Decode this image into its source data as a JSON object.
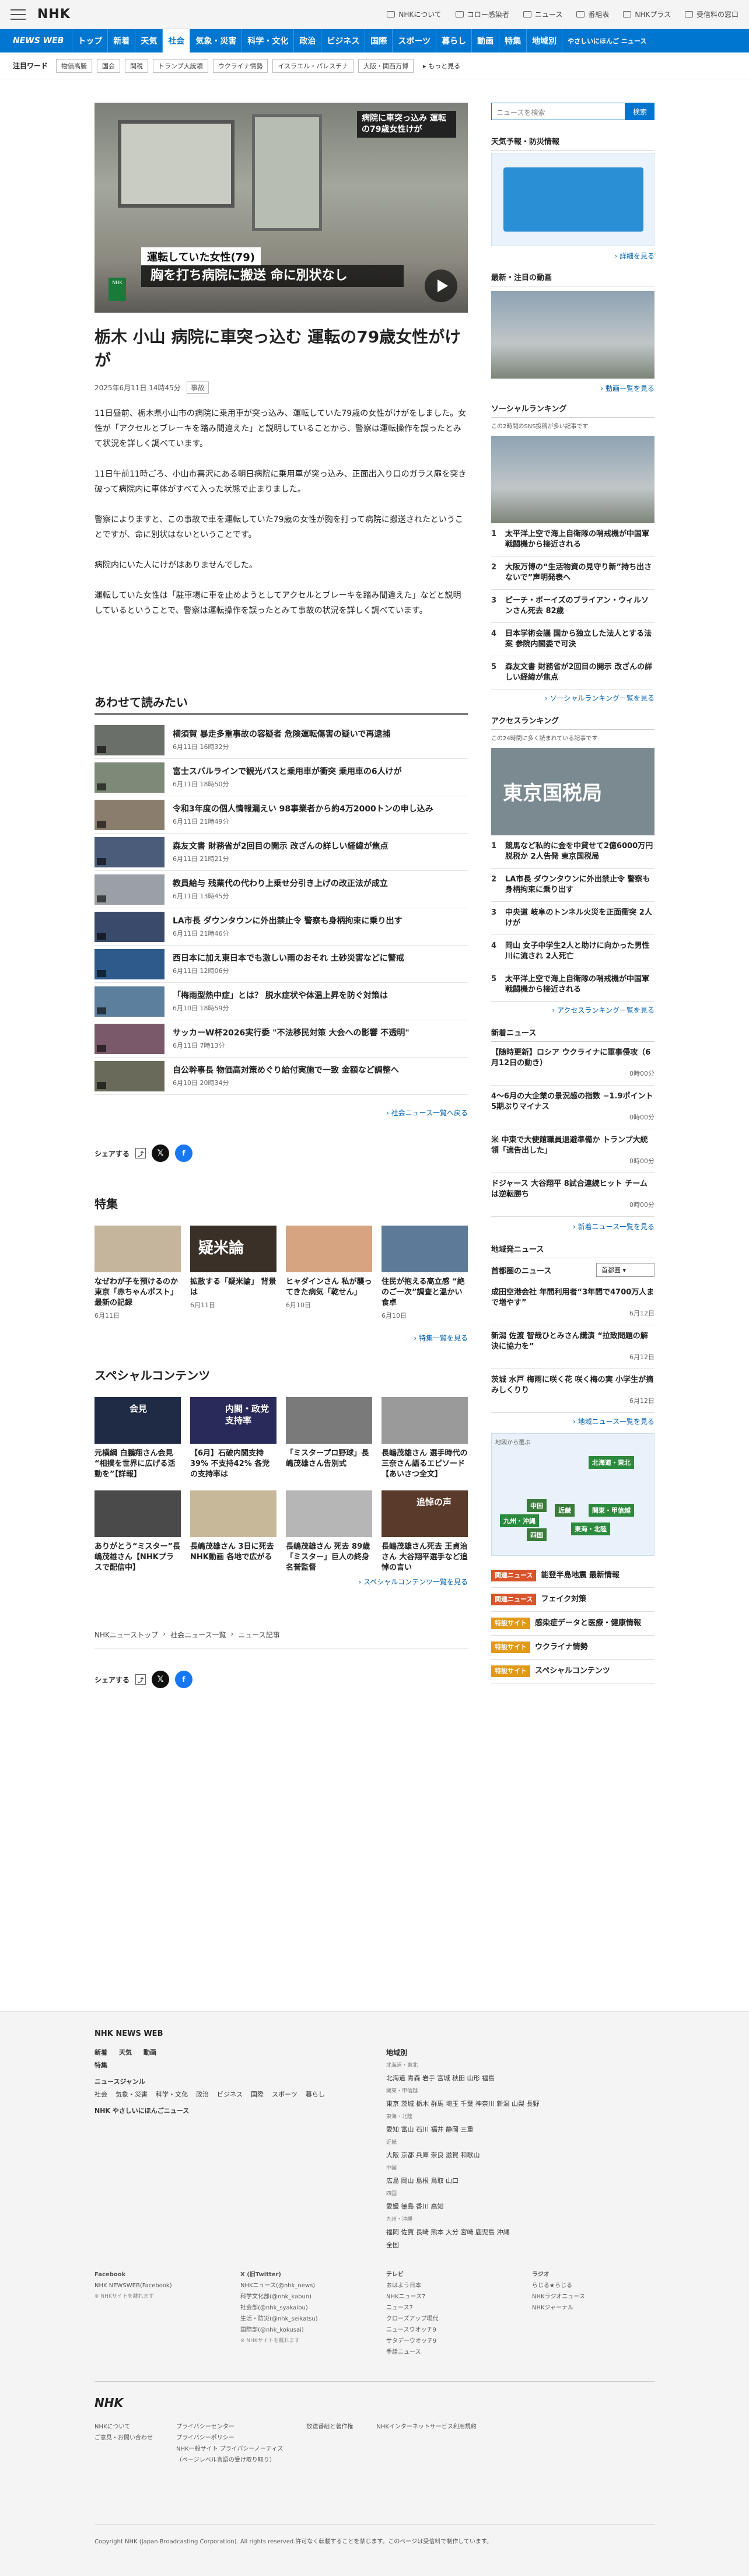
{
  "header": {
    "logo": "NHK",
    "links": [
      "NHKについて",
      "コロー感染者",
      "ニュース",
      "番組表",
      "NHKプラス",
      "受信料の窓口"
    ]
  },
  "gnav": {
    "brand": "NEWS WEB",
    "items": [
      "トップ",
      "新着",
      "天気",
      "社会",
      "気象・災害",
      "科学・文化",
      "政治",
      "ビジネス",
      "国際",
      "スポーツ",
      "暮らし",
      "動画",
      "特集",
      "地域別"
    ],
    "easy": "やさしいにほんご ニュース",
    "active": 3
  },
  "tags": {
    "label": "注目ワード",
    "items": [
      "物価高騰",
      "国会",
      "関税",
      "トランプ大統領",
      "ウクライナ情勢",
      "イスラエル・パレスチナ",
      "大阪・関西万博"
    ],
    "more": "もっと見る"
  },
  "hero": {
    "cap1": "病院に車突っ込み 運転の79歳女性けが",
    "cap2": "運転していた女性(79)",
    "cap3": "胸を打ち病院に搬送 命に別状なし",
    "mark": "NHK"
  },
  "article": {
    "title": "栃木 小山 病院に車突っ込む 運転の79歳女性がけが",
    "date": "2025年6月11日 14時45分",
    "category": "事故",
    "paragraphs": [
      "11日昼前、栃木県小山市の病院に乗用車が突っ込み、運転していた79歳の女性がけがをしました。女性が「アクセルとブレーキを踏み間違えた」と説明していることから、警察は運転操作を誤ったとみて状況を詳しく調べています。",
      "11日午前11時ごろ、小山市喜沢にある朝日病院に乗用車が突っ込み、正面出入り口のガラス扉を突き破って病院内に車体がすべて入った状態で止まりました。",
      "警察によりますと、この事故で車を運転していた79歳の女性が胸を打って病院に搬送されたということですが、命に別状はないということです。",
      "病院内にいた人にけがはありませんでした。",
      "運転していた女性は「駐車場に車を止めようとしてアクセルとブレーキを踏み間違えた」などと説明しているということで、警察は運転操作を誤ったとみて事故の状況を詳しく調べています。"
    ]
  },
  "related": {
    "heading": "あわせて読みたい",
    "more": "社会ニュース一覧へ戻る",
    "items": [
      {
        "title": "横須賀 暴走多重事故の容疑者 危険運転傷害の疑いで再逮捕",
        "date": "6月11日 16時32分",
        "color": "#6b6f6a"
      },
      {
        "title": "富士スバルラインで観光バスと乗用車が衝突 乗用車の6人けが",
        "date": "6月11日 18時50分",
        "color": "#7e8a78"
      },
      {
        "title": "令和3年度の個人情報漏えい 98事業者から約4万2000トンの申し込み",
        "date": "6月11日 21時49分",
        "color": "#8a7d6e"
      },
      {
        "title": "森友文書 財務省が2回目の開示 改ざんの詳しい経緯が焦点",
        "date": "6月11日 21時21分",
        "color": "#4b5c7a"
      },
      {
        "title": "教員給与 残業代の代わり上乗せ分引き上げの改正法が成立",
        "date": "6月11日 13時45分",
        "color": "#9aa0a6"
      },
      {
        "title": "LA市長 ダウンタウンに外出禁止令 警察も身柄拘束に乗り出す",
        "date": "6月11日 21時46分",
        "color": "#3a4a6a"
      },
      {
        "title": "西日本に加え東日本でも激しい雨のおそれ 土砂災害などに警戒",
        "date": "6月11日 12時06分",
        "color": "#2d5a8a"
      },
      {
        "title": "「梅雨型熱中症」とは？ 脱水症状や体温上昇を防ぐ対策は",
        "date": "6月10日 18時59分",
        "color": "#5b7f9c"
      },
      {
        "title": "サッカーW杯2026実行委 \"不法移民対策 大会への影響 不透明\"",
        "date": "6月11日 7時13分",
        "color": "#7a5a6a"
      },
      {
        "title": "自公幹事長 物価高対策めぐり給付実施で一致 金額など調整へ",
        "date": "6月10日 20時34分",
        "color": "#6a6a5a"
      }
    ]
  },
  "share": {
    "label": "シェアする"
  },
  "tokushu": {
    "heading": "特集",
    "more": "特集一覧を見る",
    "items": [
      {
        "title": "なぜわが子を預けるのか 東京「赤ちゃんポスト」 最新の記録",
        "date": "6月11日",
        "color": "#c4b59c"
      },
      {
        "title": "拡散する「疑米論」 背景は",
        "date": "6月11日",
        "color": "#3a3028",
        "img_text": "疑米論"
      },
      {
        "title": "ヒャダインさん 私が襲ってきた病気「乾せん」",
        "date": "6月10日",
        "color": "#d6a480"
      },
      {
        "title": "住民が抱える高立感 “絶のご一次”調査と温かい食卓",
        "date": "6月10日",
        "color": "#5d7a98"
      }
    ]
  },
  "special": {
    "heading": "スペシャルコンテンツ",
    "more": "スペシャルコンテンツ一覧を見る",
    "items": [
      {
        "title": "元横綱 白鵬翔さん会見 “相撲を世界に広げる活動を”【詳報】",
        "color": "#1f2a44",
        "img_text": "会見"
      },
      {
        "title": "【6月】石破内閣支持39% 不支持42% 各党の支持率は",
        "color": "#2a2a5a",
        "img_text": "内閣・政党支持率"
      },
      {
        "title": "「ミスタープロ野球」長嶋茂雄さん告別式",
        "color": "#7a7a7a"
      },
      {
        "title": "長嶋茂雄さん 選手時代の三奈さん語るエピソード【あいさつ全文】",
        "color": "#9a9a9a"
      },
      {
        "title": "ありがとう“ミスター”長嶋茂雄さん【NHKプラスで配信中】",
        "color": "#4a4a4a"
      },
      {
        "title": "長嶋茂雄さん 3日に死去 NHK動画 各地で広がる",
        "color": "#c8b89a"
      },
      {
        "title": "長嶋茂雄さん 死去 89歳 「ミスター」巨人の終身名誉監督",
        "color": "#b6b6b6"
      },
      {
        "title": "長嶋茂雄さん死去 王貞治さん 大谷翔平選手など追悼の言い",
        "color": "#5a3a2a",
        "img_text": "追悼の声"
      }
    ]
  },
  "breadcrumb": [
    "NHKニューストップ",
    "社会ニュース一覧",
    "ニュース記事"
  ],
  "side": {
    "search": {
      "placeholder": "ニュースを検索",
      "button": "検索"
    },
    "weather": {
      "heading": "天気予報・防災情報",
      "more": "詳細を見る"
    },
    "video": {
      "heading": "最新・注目の動画",
      "more": "動画一覧を見る"
    },
    "social": {
      "heading": "ソーシャルランキング",
      "sub": "この2時間のSNS投稿が多い記事です",
      "more": "ソーシャルランキング一覧を見る",
      "items": [
        "太平洋上空で海上自衛隊の哨戒機が中国軍戦闘機から接近される",
        "大阪万博の“生活物資の見守り新”持ち出さないで”声明発表へ",
        "ピーチ・ボーイズのブライアン・ウィルソンさん死去 82歳",
        "日本学術会議 国から独立した法人とする法案 参院内閣委で可決",
        "森友文書 財務省が2回目の開示 改ざんの詳しい経緯が焦点"
      ]
    },
    "access": {
      "heading": "アクセスランキング",
      "sub": "この24時間に多く読まれている記事です",
      "img_text": "東京国税局",
      "more": "アクセスランキング一覧を見る",
      "items": [
        "競馬など私的に金を中貸せて2億6000万円脱税か 2人告発 東京国税局",
        "LA市長 ダウンタウンに外出禁止令 警察も身柄拘束に乗り出す",
        "中央道 岐阜のトンネル火災を正面衝突 2人けが",
        "岡山 女子中学生2人と助けに向かった男性 川に流され 2人死亡",
        "太平洋上空で海上自衛隊の哨戒機が中国軍戦闘機から接近される"
      ]
    },
    "new": {
      "heading": "新着ニュース",
      "more": "新着ニュース一覧を見る",
      "items": [
        {
          "title": "【随時更新】ロシア ウクライナに軍事侵攻（6月12日の動き）",
          "date": "0時00分"
        },
        {
          "title": "4〜6月の大企業の景況感の指数 −1.9ポイント 5期ぶりマイナス",
          "date": "0時00分"
        },
        {
          "title": "米 中東で大使館職員退避準備か トランプ大統領「適告出した」",
          "date": "0時00分"
        },
        {
          "title": "ドジャース 大谷翔平 8試合連続ヒット チームは逆転勝ち",
          "date": "0時00分"
        }
      ]
    },
    "local": {
      "heading": "地域発ニュース",
      "area_label": "首都圏のニュース",
      "select": "首都圏",
      "more": "地域ニュース一覧を見る",
      "items": [
        {
          "title": "成田空港会社 年間利用者“3年間で4700万人まで増やす”",
          "date": "6月12日"
        },
        {
          "title": "新潟 佐渡 智哉ひとみさん講演 “拉致問題の解決に協力を”",
          "date": "6月12日"
        },
        {
          "title": "茨城 水戸 梅雨に咲く花 咲く梅の実 小学生が摘みしくりり",
          "date": "6月12日"
        }
      ]
    },
    "areamap": {
      "title": "地図から選ぶ",
      "regions": [
        "北海道・東北",
        "中国",
        "近畿",
        "関東・甲信越",
        "九州・沖縄",
        "四国",
        "東海・北陸"
      ]
    },
    "pills": [
      {
        "tag": "関連ニュース",
        "text": "能登半島地震 最新情報",
        "color": "#d9532b"
      },
      {
        "tag": "関連ニュース",
        "text": "フェイク対策",
        "color": "#d9532b"
      },
      {
        "tag": "特設サイト",
        "text": "感染症データと医療・健康情報",
        "color": "#e09a18"
      },
      {
        "tag": "特設サイト",
        "text": "ウクライナ情勢",
        "color": "#e09a18"
      },
      {
        "tag": "特設サイト",
        "text": "スペシャルコンテンツ",
        "color": "#e09a18"
      }
    ]
  },
  "footer": {
    "title": "NHK NEWS WEB",
    "row1": [
      "新着",
      "天気",
      "動画"
    ],
    "tokushu": "特集",
    "genre_label": "ニュースジャンル",
    "genres": [
      "社会",
      "気象・災害",
      "科学・文化",
      "政治",
      "ビジネス",
      "国際",
      "スポーツ",
      "暮らし"
    ],
    "easy": "NHK やさしいにほんごニュース",
    "region_label": "地域別",
    "regions": [
      "北海道・東北",
      "北海道 青森 岩手 宮城 秋田 山形 福島",
      "関東・甲信越",
      "東京 茨城 栃木 群馬 埼玉 千葉 神奈川 新潟 山梨 長野",
      "東海・北陸",
      "愛知 富山 石川 福井 静岡 三重",
      "近畿",
      "大阪 京都 兵庫 奈良 滋賀 和歌山",
      "中国",
      "広島 岡山 島根 鳥取 山口",
      "四国",
      "愛媛 徳島 香川 高知",
      "九州・沖縄",
      "福岡 佐賀 長崎 熊本 大分 宮崎 鹿児島 沖縄",
      "全国"
    ],
    "fb_label": "Facebook",
    "fb": [
      "NHK NEWSWEB(Facebook)"
    ],
    "x_label": "X (旧Twitter)",
    "x": [
      "NHKニュース(@nhk_news)",
      "科学文化部(@nhk_kabun)",
      "社会部(@nhk_syakaibu)",
      "生活・防災(@nhk_seikatsu)",
      "国際部(@nhk_kokusai)"
    ],
    "tv_label": "テレビ",
    "tv": [
      "おはよう日本",
      "NHKニュース7",
      "ニュース7",
      "クローズアップ現代",
      "ニュースウオッチ9",
      "サタデーウオッチ9",
      "手話ニュース"
    ],
    "radio_label": "ラジオ",
    "radio": [
      "らじる★らじる",
      "NHKラジオニュース",
      "NHKジャーナル"
    ],
    "note": "※ NHKサイトを離れます",
    "logo": "NHK",
    "bottom": [
      "NHKについて",
      "ご意見・お問い合わせ",
      "プライバシーセンター",
      "プライバシーポリシー",
      "NHK一般サイト プライバシーノーティス",
      "（ページレベル言語の受け取り取り）",
      "放送番組と著作権",
      "NHKインターネットサービス利用規約"
    ],
    "copyright": "Copyright NHK (Japan Broadcasting Corporation). All rights reserved.許可なく転載することを禁じます。このページは受信料で制作しています。"
  }
}
